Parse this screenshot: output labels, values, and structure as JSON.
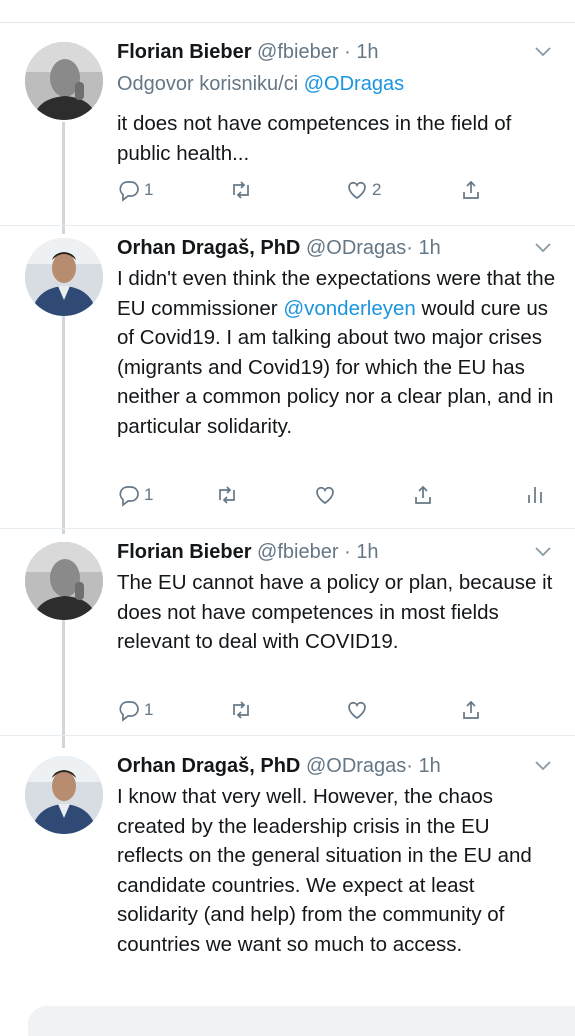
{
  "tweets": [
    {
      "name": "Florian Bieber",
      "handle": "@fbieber",
      "dot": "·",
      "time": "1h",
      "reply_prefix": "Odgovor korisniku/ci ",
      "reply_mention": "@ODragas",
      "text": "it does not have competences in the field of public health...",
      "reply_count": "1",
      "retweet_count": "",
      "like_count": "2",
      "avatar": "florian-bieber-avatar"
    },
    {
      "name": "Orhan Dragaš, PhD",
      "handle": "@ODragas",
      "dot": "·",
      "time": "1h",
      "text_before": "I didn't even think the expectations were that the EU commissioner ",
      "text_mention": "@vonderleyen",
      "text_after": " would cure us of Covid19.  I am talking about two major crises (migrants and Covid19) for which the EU has neither a common policy nor a clear plan, and in particular solidarity.",
      "reply_count": "1",
      "retweet_count": "",
      "like_count": "",
      "avatar": "orhan-dragas-avatar"
    },
    {
      "name": "Florian Bieber",
      "handle": "@fbieber",
      "dot": "·",
      "time": "1h",
      "text": "The EU cannot have a policy or plan, because it does not have competences in most fields relevant to deal with COVID19.",
      "reply_count": "1",
      "retweet_count": "",
      "like_count": "",
      "avatar": "florian-bieber-avatar"
    },
    {
      "name": "Orhan Dragaš, PhD",
      "handle": "@ODragas",
      "dot": "·",
      "time": "1h",
      "text": "I know that very well. However, the chaos created by the leadership crisis in the EU reflects on the general situation in the EU and candidate countries. We expect at least solidarity (and help) from the community of countries we want so much to access.",
      "avatar": "orhan-dragas-avatar"
    }
  ],
  "icons": {
    "reply": "reply-icon",
    "retweet": "retweet-icon",
    "like": "heart-icon",
    "share": "share-icon",
    "analytics": "analytics-icon",
    "more": "chevron-down-icon"
  },
  "colors": {
    "link": "#1b95e0",
    "secondary": "#657786",
    "thread_line": "#cfd6dc"
  }
}
